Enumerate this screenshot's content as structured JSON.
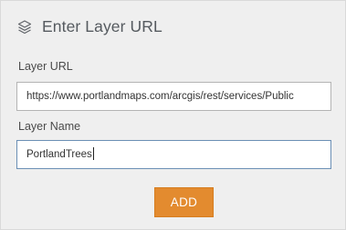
{
  "dialog": {
    "title": "Enter Layer URL",
    "title_icon": "layers-icon"
  },
  "layer_url": {
    "label": "Layer URL",
    "value": "https://www.portlandmaps.com/arcgis/rest/services/Public"
  },
  "layer_name": {
    "label": "Layer Name",
    "value": "PortlandTrees"
  },
  "add_button": {
    "label": "ADD",
    "color": "#e38b2f"
  },
  "colors": {
    "panel_background": "#efefef",
    "text": "#555a5f",
    "active_border": "#6b8fb5"
  }
}
